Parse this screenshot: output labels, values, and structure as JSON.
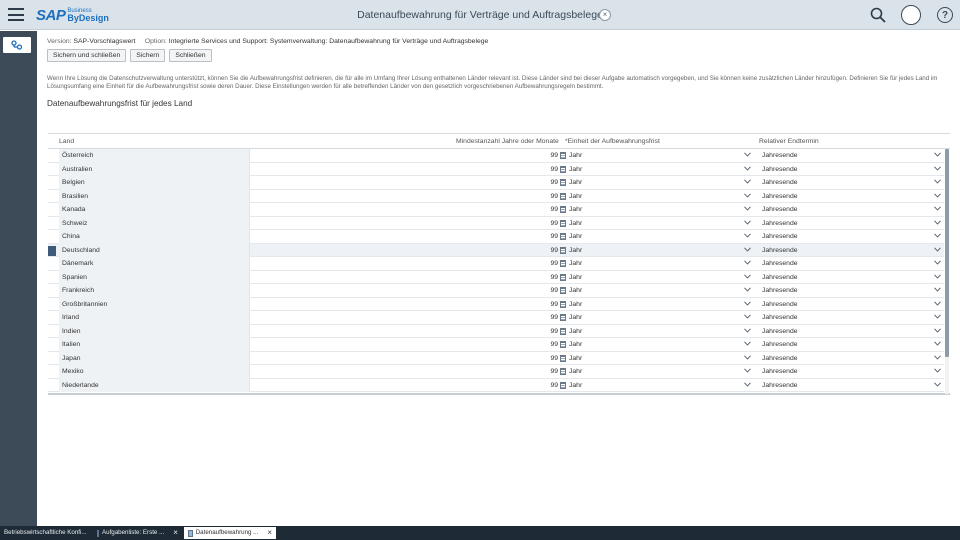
{
  "header": {
    "logo_sap": "SAP",
    "logo_business": "Business",
    "logo_bydesign": "ByDesign",
    "title": "Datenaufbewahrung für Verträge und Auftragsbelege",
    "close_glyph": "×",
    "help_glyph": "?",
    "icons": [
      "menu-icon",
      "close-icon",
      "search-icon",
      "user-avatar",
      "help-icon"
    ]
  },
  "nav": {
    "active_icon": "work-center-icon"
  },
  "info": {
    "version_label": "Version:",
    "version_value": "SAP-Vorschlagswert",
    "option_label": "Option:",
    "option_value": "Integrierte Services und Support: Systemverwaltung: Datenaufbewahrung für Verträge und Auftragsbelege"
  },
  "toolbar": {
    "save_close": "Sichern und schließen",
    "save": "Sichern",
    "close": "Schließen"
  },
  "description": "Wenn Ihre Lösung die Datenschutzverwaltung unterstützt, können Sie die Aufbewahrungsfrist definieren, die für alle im Umfang Ihrer Lösung enthaltenen Länder relevant ist. Diese Länder sind bei dieser Aufgabe automatisch vorgegeben, und Sie können keine zusätzlichen Länder hinzufügen. Definieren Sie für jedes Land im Lösungsumfang eine Einheit für die Aufbewahrungsfrist sowie deren Dauer. Diese Einstellungen werden für alle betreffenden Länder von den gesetzlich vorgeschriebenen Aufbewahrungsregeln bestimmt.",
  "section_title": "Datenaufbewahrungsfrist für jedes Land",
  "table": {
    "columns": {
      "land": "Land",
      "min": "Mindestanzahl Jahre oder Monate",
      "unit": "*Einheit der Aufbewahrungsfrist",
      "end": "Relativer Endtermin"
    },
    "selected_row": 7,
    "rows": [
      {
        "land": "Österreich",
        "min": "99",
        "unit": "Jahr",
        "end": "Jahresende"
      },
      {
        "land": "Australien",
        "min": "99",
        "unit": "Jahr",
        "end": "Jahresende"
      },
      {
        "land": "Belgien",
        "min": "99",
        "unit": "Jahr",
        "end": "Jahresende"
      },
      {
        "land": "Brasilien",
        "min": "99",
        "unit": "Jahr",
        "end": "Jahresende"
      },
      {
        "land": "Kanada",
        "min": "99",
        "unit": "Jahr",
        "end": "Jahresende"
      },
      {
        "land": "Schweiz",
        "min": "99",
        "unit": "Jahr",
        "end": "Jahresende"
      },
      {
        "land": "China",
        "min": "99",
        "unit": "Jahr",
        "end": "Jahresende"
      },
      {
        "land": "Deutschland",
        "min": "99",
        "unit": "Jahr",
        "end": "Jahresende"
      },
      {
        "land": "Dänemark",
        "min": "99",
        "unit": "Jahr",
        "end": "Jahresende"
      },
      {
        "land": "Spanien",
        "min": "99",
        "unit": "Jahr",
        "end": "Jahresende"
      },
      {
        "land": "Frankreich",
        "min": "99",
        "unit": "Jahr",
        "end": "Jahresende"
      },
      {
        "land": "Großbritannien",
        "min": "99",
        "unit": "Jahr",
        "end": "Jahresende"
      },
      {
        "land": "Irland",
        "min": "99",
        "unit": "Jahr",
        "end": "Jahresende"
      },
      {
        "land": "Indien",
        "min": "99",
        "unit": "Jahr",
        "end": "Jahresende"
      },
      {
        "land": "Italien",
        "min": "99",
        "unit": "Jahr",
        "end": "Jahresende"
      },
      {
        "land": "Japan",
        "min": "99",
        "unit": "Jahr",
        "end": "Jahresende"
      },
      {
        "land": "Mexiko",
        "min": "99",
        "unit": "Jahr",
        "end": "Jahresende"
      },
      {
        "land": "Niederlande",
        "min": "99",
        "unit": "Jahr",
        "end": "Jahresende"
      }
    ]
  },
  "taskbar": {
    "items": [
      {
        "label": "Betriebswirtschaftliche Konfi...",
        "active": false
      },
      {
        "label": "Aufgabenliste: Erste ...",
        "active": false
      },
      {
        "label": "Datenaufbewahrung ...",
        "active": true
      }
    ],
    "close_glyph": "×"
  },
  "colors": {
    "header_bg": "#dbe3ea",
    "nav_bg": "#3d4b59",
    "taskbar_bg": "#1e2a36",
    "selection_marker": "#3d5a7a",
    "brand_blue": "#1c6fbf"
  }
}
